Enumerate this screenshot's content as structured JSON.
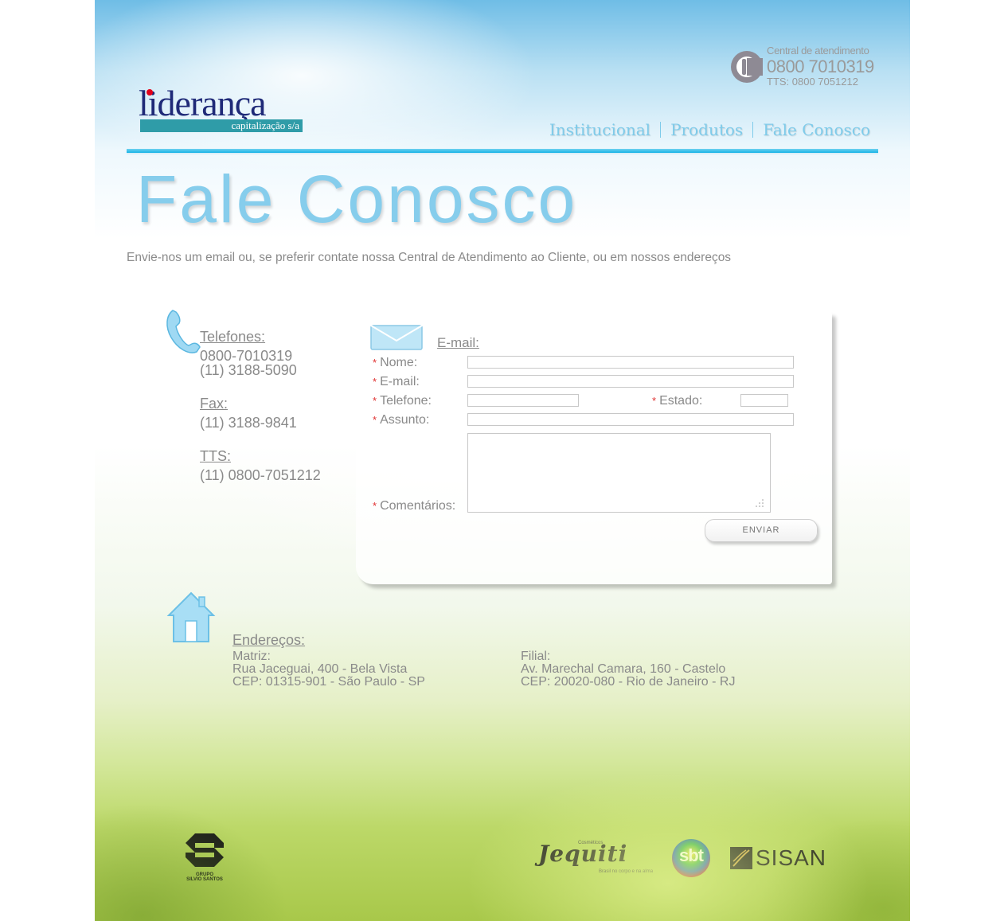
{
  "brand": {
    "logo_word": "liderança",
    "logo_sub": "capitalização s/a"
  },
  "call_center": {
    "label": "Central de atendimento",
    "number": "0800 7010319",
    "tts": "TTS: 0800 7051212"
  },
  "nav": {
    "items": [
      {
        "label": "Institucional"
      },
      {
        "label": "Produtos"
      },
      {
        "label": "Fale Conosco"
      }
    ]
  },
  "page": {
    "title": "Fale Conosco",
    "intro": "Envie-nos um email ou, se preferir contate nossa Central de Atendimento ao Cliente, ou em nossos endereços"
  },
  "contacts": {
    "phones_heading": "Telefones:",
    "phone_1": "0800-7010319",
    "phone_2": "(11) 3188-5090",
    "fax_heading": "Fax:",
    "fax": "(11) 3188-9841",
    "tts_heading": "TTS:",
    "tts": "(11) 0800-7051212"
  },
  "form": {
    "heading": "E-mail:",
    "required_mark": "*",
    "name_label": "Nome:",
    "email_label": "E-mail:",
    "phone_label": "Telefone:",
    "state_label": "Estado:",
    "subject_label": "Assunto:",
    "comments_label": "Comentários:",
    "submit_label": "ENVIAR"
  },
  "addresses": {
    "heading": "Endereços:",
    "matriz": {
      "title": "Matriz:",
      "line1": "Rua Jaceguai, 400 - Bela Vista",
      "line2": "CEP: 01315-901 - São Paulo - SP"
    },
    "filial": {
      "title": "Filial:",
      "line1": "Av. Marechal Camara, 160 - Castelo",
      "line2": "CEP: 20020-080 - Rio de Janeiro - RJ"
    }
  },
  "footer": {
    "grupo_line1": "GRUPO",
    "grupo_line2": "SILVIO SANTOS",
    "jequiti_small": "Cosméticos",
    "jequiti_name": "Jequiti",
    "jequiti_tagline": "Brasil no corpo e na alma",
    "sbt": "sbt",
    "sisan": "SISAN"
  },
  "colors": {
    "accent_blue": "#86cdec",
    "text_gray": "#8a8a8a",
    "required_red": "#e03030",
    "logo_navy": "#1f2a78",
    "logo_teal": "#2f9ca8"
  }
}
